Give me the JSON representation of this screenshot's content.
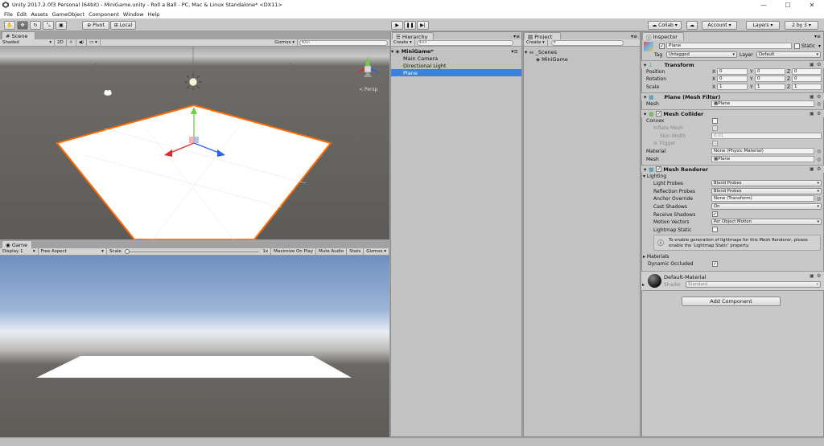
{
  "window": {
    "title": "Unity 2017.2.0f3 Personal (64bit) - MiniGame.unity - Roll a Ball - PC, Mac & Linux Standalone* <DX11>",
    "minimize": "—",
    "maximize": "☐",
    "close": "✕"
  },
  "menu": [
    "File",
    "Edit",
    "Assets",
    "GameObject",
    "Component",
    "Window",
    "Help"
  ],
  "toolbar": {
    "pivot": "Pivot",
    "local": "Local",
    "collab": "Collab ▾",
    "account": "Account",
    "layers": "Layers",
    "layout": "2 by 3"
  },
  "scene": {
    "tab": "Scene",
    "shading": "Shaded",
    "mode2d": "2D",
    "gizmos": "Gizmos",
    "search_placeholder": "All",
    "persp": "< Persp"
  },
  "game": {
    "tab": "Game",
    "display": "Display 1",
    "aspect": "Free Aspect",
    "scale_label": "Scale",
    "scale_value": "1x",
    "maximize_on_play": "Maximize On Play",
    "mute_audio": "Mute Audio",
    "stats": "Stats",
    "gizmos": "Gizmos"
  },
  "hierarchy": {
    "tab": "Hierarchy",
    "create": "Create",
    "search_placeholder": "All",
    "scene_name": "MiniGame*",
    "items": [
      "Main Camera",
      "Directional Light",
      "Plane"
    ],
    "selected_index": 2
  },
  "project": {
    "tab": "Project",
    "create": "Create",
    "folder": "_Scenes",
    "scene": "MiniGame"
  },
  "inspector": {
    "tab": "Inspector",
    "object_name": "Plane",
    "static_label": "Static",
    "tag_label": "Tag",
    "tag_value": "Untagged",
    "layer_label": "Layer",
    "layer_value": "Default",
    "transform": {
      "title": "Transform",
      "position_label": "Position",
      "rotation_label": "Rotation",
      "scale_label": "Scale",
      "position": [
        "0",
        "0",
        "0"
      ],
      "rotation": [
        "0",
        "0",
        "0"
      ],
      "scale": [
        "1",
        "1",
        "1"
      ],
      "axis_x": "X",
      "axis_y": "Y",
      "axis_z": "Z"
    },
    "mesh_filter": {
      "title": "Plane (Mesh Filter)",
      "mesh_label": "Mesh",
      "mesh_value": "Plane"
    },
    "mesh_collider": {
      "title": "Mesh Collider",
      "convex": "Convex",
      "inflate_mesh": "Inflate Mesh",
      "skin_width": "Skin Width",
      "skin_width_value": "0.01",
      "is_trigger": "Is Trigger",
      "material_label": "Material",
      "material_value": "None (Physic Material)",
      "mesh_label": "Mesh",
      "mesh_value": "Plane"
    },
    "mesh_renderer": {
      "title": "Mesh Renderer",
      "lighting": "Lighting",
      "light_probes": "Light Probes",
      "light_probes_value": "Blend Probes",
      "reflection_probes": "Reflection Probes",
      "reflection_probes_value": "Blend Probes",
      "anchor_override": "Anchor Override",
      "anchor_override_value": "None (Transform)",
      "cast_shadows": "Cast Shadows",
      "cast_shadows_value": "On",
      "receive_shadows": "Receive Shadows",
      "motion_vectors": "Motion Vectors",
      "motion_vectors_value": "Per Object Motion",
      "lightmap_static": "Lightmap Static",
      "info_line1": "To enable generation of lightmaps for this Mesh Renderer, please",
      "info_line2": "enable the 'Lightmap Static' property.",
      "materials": "Materials",
      "dynamic_occluded": "Dynamic Occluded"
    },
    "material": {
      "name": "Default-Material",
      "shader_label": "Shader",
      "shader_value": "Standard"
    },
    "add_component": "Add Component"
  },
  "colors": {
    "selection": "#3d80df",
    "plane_outline": "#ff6a00",
    "scene_ground": "#5d5b58",
    "game_sky": "#6f8fbf"
  }
}
